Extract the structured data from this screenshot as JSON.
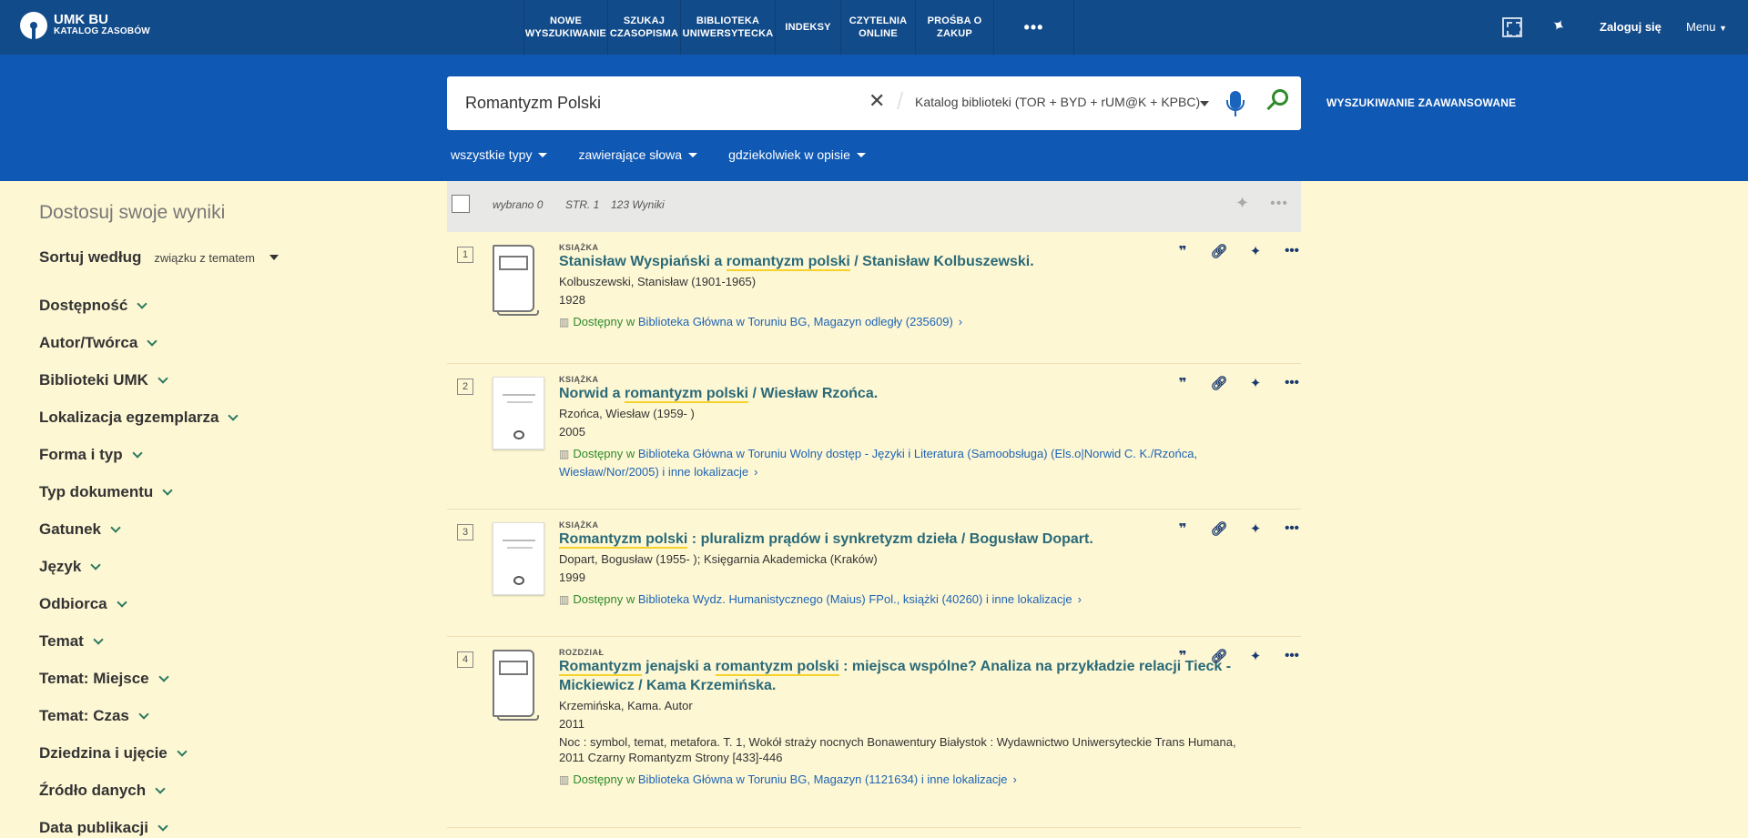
{
  "header": {
    "logo_title": "UMK BU",
    "logo_sub": "KATALOG ZASOBÓW",
    "nav": [
      "NOWE WYSZUKIWANIE",
      "SZUKAJ CZASOPISMA",
      "BIBLIOTEKA UNIWERSYTECKA",
      "INDEKSY",
      "CZYTELNIA ONLINE",
      "PROŚBA O ZAKUP"
    ],
    "nav_more": "•••",
    "login": "Zaloguj się",
    "menu": "Menu"
  },
  "search": {
    "query": "Romantyzm Polski",
    "scope": "Katalog biblioteki (TOR + BYD + rUM@K + KPBC)",
    "advanced": "WYSZUKIWANIE ZAAWANSOWANE",
    "filters": [
      "wszystkie typy",
      "zawierające słowa",
      "gdziekolwiek w opisie"
    ]
  },
  "sidebar": {
    "title": "Dostosuj swoje wyniki",
    "sort_label": "Sortuj według",
    "sort_value": "związku z tematem",
    "facets": [
      "Dostępność",
      "Autor/Twórca",
      "Biblioteki UMK",
      "Lokalizacja egzemplarza",
      "Forma i typ",
      "Typ dokumentu",
      "Gatunek",
      "Język",
      "Odbiorca",
      "Temat",
      "Temat: Miejsce",
      "Temat: Czas",
      "Dziedzina i ujęcie",
      "Źródło danych",
      "Data publikacji"
    ]
  },
  "results_bar": {
    "selected": "wybrano 0",
    "page": "STR. 1",
    "count": "123 Wyniki"
  },
  "records": [
    {
      "num": "1",
      "type": "KSIĄŻKA",
      "thumb": "book",
      "title_parts": [
        "Stanisław Wyspiański a ",
        "romantyzm polski",
        " / Stanisław Kolbuszewski."
      ],
      "author": "Kolbuszewski, Stanisław (1901-1965)",
      "year": "1928",
      "avail_status": "Dostępny w",
      "avail_loc": "Biblioteka Główna w Toruniu  BG, Magazyn odległy (235609)"
    },
    {
      "num": "2",
      "type": "KSIĄŻKA",
      "thumb": "cover",
      "title_parts": [
        "Norwid a ",
        "romantyzm polski",
        " / Wiesław Rzońca."
      ],
      "author": "Rzońca, Wiesław (1959- )",
      "year": "2005",
      "avail_status": "Dostępny w",
      "avail_loc": "Biblioteka Główna w Toruniu  Wolny dostęp - Języki i Literatura (Samoobsługa) (Els.o|Norwid C. K./Rzońca, Wiesław/Nor/2005) i inne lokalizacje"
    },
    {
      "num": "3",
      "type": "KSIĄŻKA",
      "thumb": "cover",
      "title_parts": [
        "",
        "Romantyzm polski",
        " : pluralizm prądów i synkretyzm dzieła / Bogusław Dopart."
      ],
      "author": "Dopart, Bogusław (1955- ); Księgarnia Akademicka (Kraków)",
      "year": "1999",
      "avail_status": "Dostępny w",
      "avail_loc": "Biblioteka Wydz. Humanistycznego (Maius)  FPol., książki (40260) i inne lokalizacje"
    },
    {
      "num": "4",
      "type": "ROZDZIAŁ",
      "thumb": "book",
      "title_parts": [
        "Romantyzm",
        " jenajski a ",
        "romantyzm polski",
        " : miejsca wspólne? Analiza na przykładzie relacji Tieck - Mickiewicz / Kama Krzemińska."
      ],
      "author": "Krzemińska, Kama. Autor",
      "year": "2011",
      "source": "Noc : symbol, temat, metafora. T. 1, Wokół straży nocnych Bonawentury Białystok : Wydawnictwo Uniwersyteckie Trans Humana, 2011 Czarny Romantyzm Strony [433]-446",
      "avail_status": "Dostępny w",
      "avail_loc": "Biblioteka Główna w Toruniu  BG, Magazyn (1121634) i inne lokalizacje"
    }
  ]
}
